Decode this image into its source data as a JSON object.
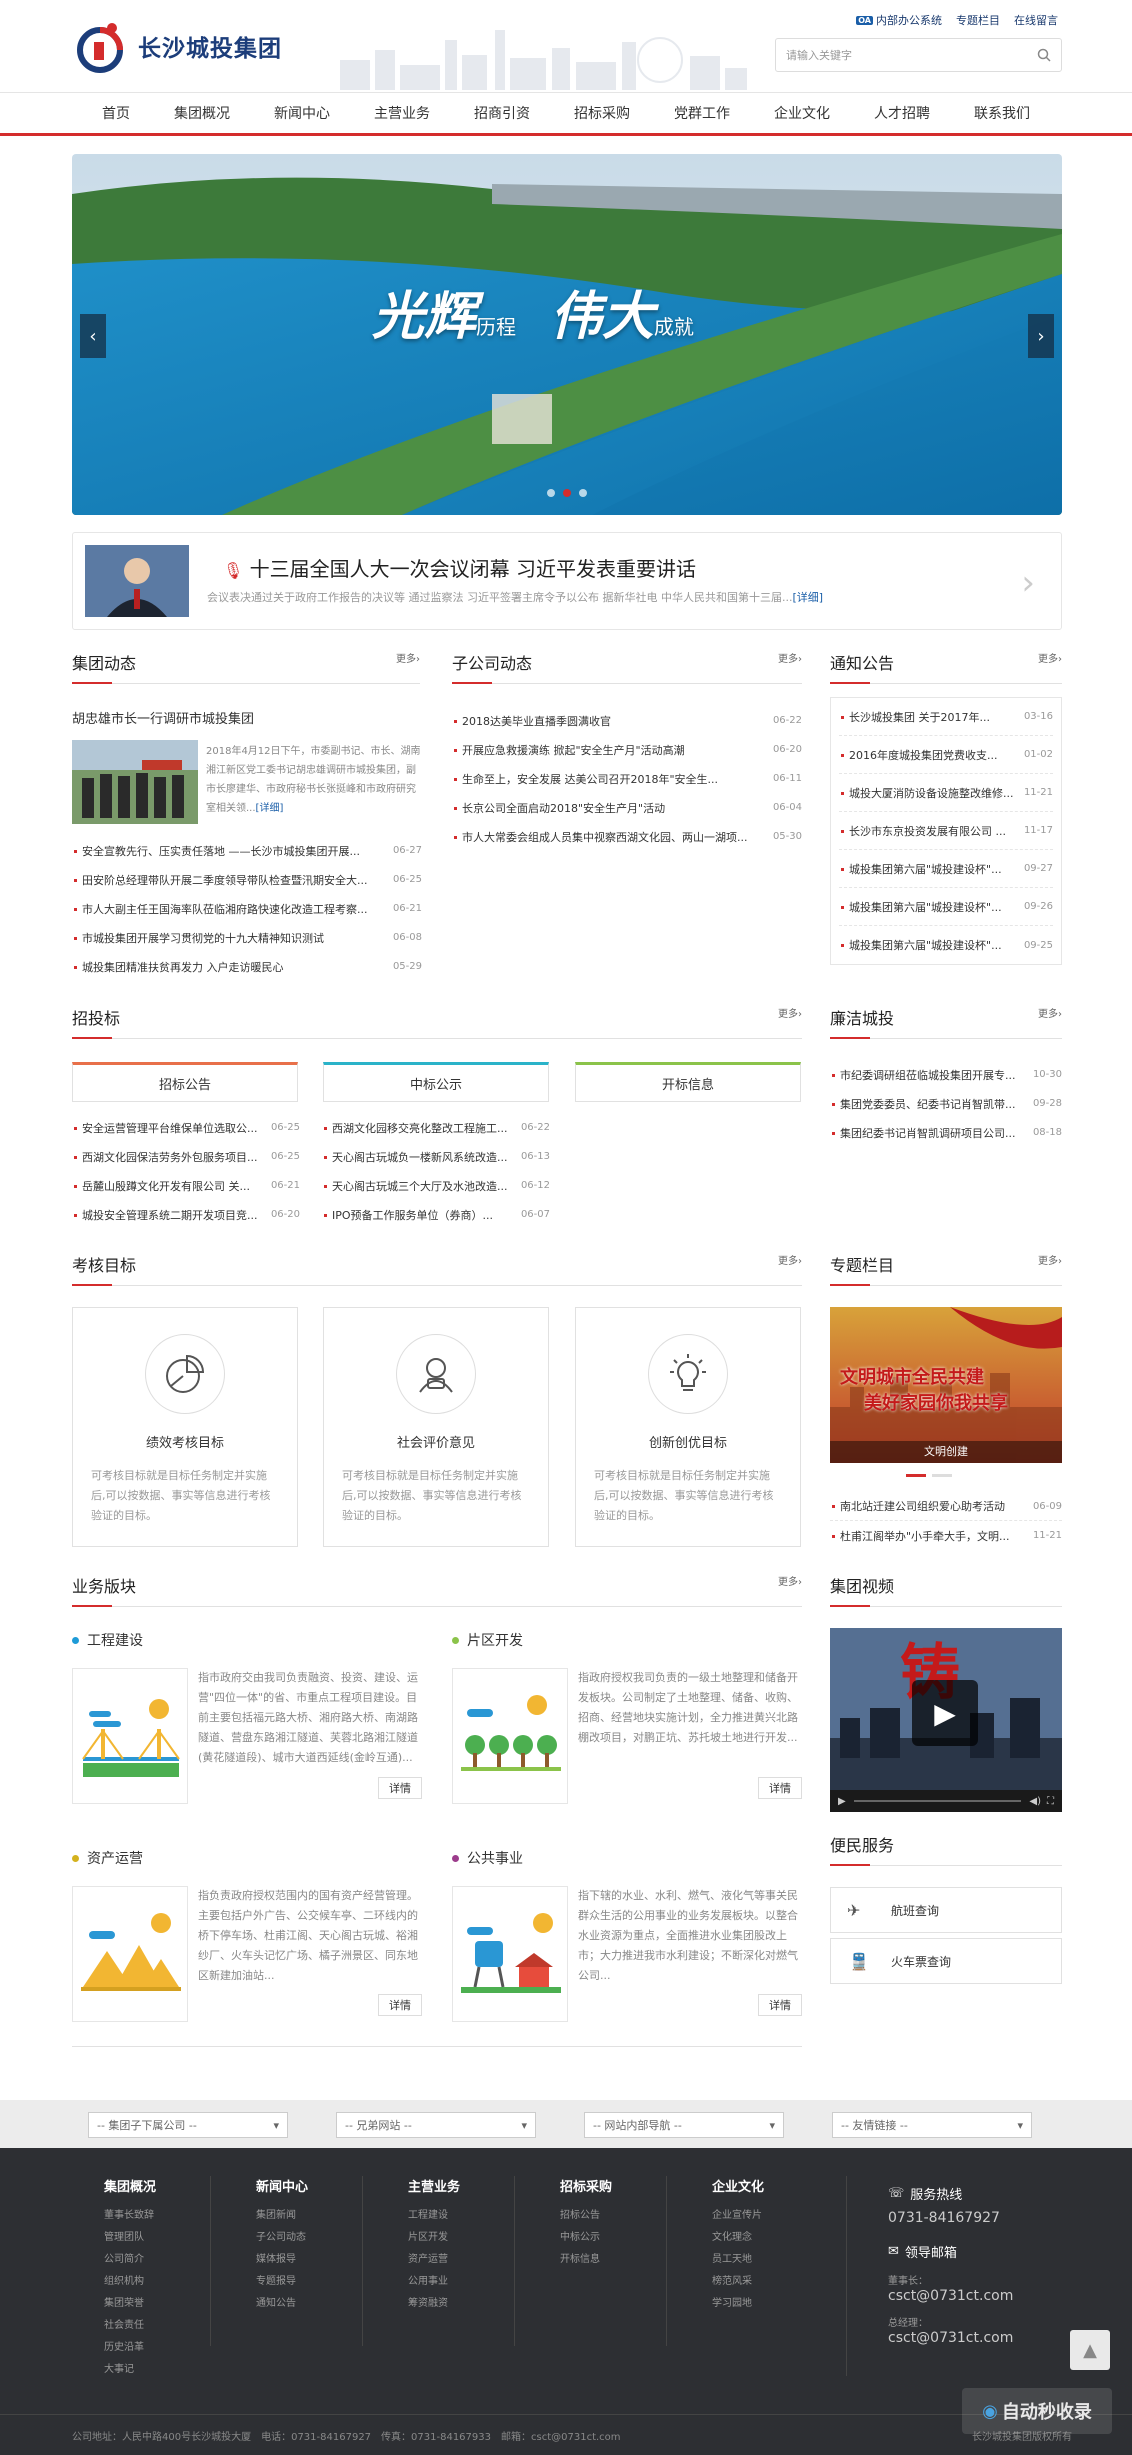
{
  "header": {
    "oa_badge": "OA",
    "top_links": [
      "内部办公系统",
      "专题栏目",
      "在线留言"
    ],
    "logo_text": "长沙城投集团",
    "search_placeholder": "请输入关键字"
  },
  "nav": [
    "首页",
    "集团概况",
    "新闻中心",
    "主营业务",
    "招商引资",
    "招标采购",
    "党群工作",
    "企业文化",
    "人才招聘",
    "联系我们"
  ],
  "banner": {
    "slogan_big_1": "光辉",
    "slogan_small_1": "历程",
    "slogan_big_2": "伟大",
    "slogan_small_2": "成就"
  },
  "headline": {
    "title": "十三届全国人大一次会议闭幕 习近平发表重要讲话",
    "summary": "会议表决通过关于政府工作报告的决议等 通过监察法 习近平签署主席令予以公布 据新华社电 中华人民共和国第十三届...",
    "more": "[详细]"
  },
  "news": {
    "title": "集团动态",
    "more": "更多",
    "feature_title": "胡忠雄市长一行调研市城投集团",
    "feature_text": "2018年4月12日下午，市委副书记、市长、湖南湘江新区党工委书记胡忠雄调研市城投集团，副市长廖建华、市政府秘书长张挺峰和市政府研究室相关领...",
    "feature_more": "[详细]",
    "items": [
      {
        "t": "安全宣教先行、压实责任落地 ——长沙市城投集团开展...",
        "d": "06-27"
      },
      {
        "t": "田安阶总经理带队开展二季度领导带队检查暨汛期安全大...",
        "d": "06-25"
      },
      {
        "t": "市人大副主任王国海率队莅临湘府路快速化改造工程考察...",
        "d": "06-21"
      },
      {
        "t": "市城投集团开展学习贯彻党的十九大精神知识测试",
        "d": "06-08"
      },
      {
        "t": "城投集团精准扶贫再发力 入户走访暖民心",
        "d": "05-29"
      }
    ]
  },
  "sub_news": {
    "title": "子公司动态",
    "more": "更多",
    "items": [
      {
        "t": "2018达美毕业直播季圆满收官",
        "d": "06-22"
      },
      {
        "t": "开展应急救援演练 掀起\"安全生产月\"活动高潮",
        "d": "06-20"
      },
      {
        "t": "生命至上，安全发展 达美公司召开2018年\"安全生...",
        "d": "06-11"
      },
      {
        "t": "长京公司全面启动2018\"安全生产月\"活动",
        "d": "06-04"
      },
      {
        "t": "市人大常委会组成人员集中视察西湖文化园、两山一湖项...",
        "d": "05-30"
      }
    ]
  },
  "notice": {
    "title": "通知公告",
    "more": "更多",
    "items": [
      {
        "t": "长沙城投集团 关于2017年...",
        "d": "03-16"
      },
      {
        "t": "2016年度城投集团党费收支...",
        "d": "01-02"
      },
      {
        "t": "城投大厦消防设备设施整改维修...",
        "d": "11-21"
      },
      {
        "t": "长沙市东京投资发展有限公司 ...",
        "d": "11-17"
      },
      {
        "t": "城投集团第六届\"城投建设杯\"...",
        "d": "09-27"
      },
      {
        "t": "城投集团第六届\"城投建设杯\"...",
        "d": "09-26"
      },
      {
        "t": "城投集团第六届\"城投建设杯\"...",
        "d": "09-25"
      }
    ]
  },
  "bidding": {
    "title": "招投标",
    "more": "更多",
    "tabs": [
      "招标公告",
      "中标公示",
      "开标信息"
    ],
    "col1": [
      {
        "t": "安全运营管理平台维保单位选取公...",
        "d": "06-25"
      },
      {
        "t": "西湖文化园保洁劳务外包服务项目...",
        "d": "06-25"
      },
      {
        "t": "岳麓山殷蹲文化开发有限公司 关...",
        "d": "06-21"
      },
      {
        "t": "城投安全管理系统二期开发项目竞...",
        "d": "06-20"
      }
    ],
    "col2": [
      {
        "t": "西湖文化园移交亮化整改工程施工...",
        "d": "06-22"
      },
      {
        "t": "天心阁古玩城负一楼新风系统改造...",
        "d": "06-13"
      },
      {
        "t": "天心阁古玩城三个大厅及水池改造...",
        "d": "06-12"
      },
      {
        "t": "IPO预备工作服务单位（券商）...",
        "d": "06-07"
      }
    ]
  },
  "integrity": {
    "title": "廉洁城投",
    "more": "更多",
    "items": [
      {
        "t": "市纪委调研组莅临城投集团开展专...",
        "d": "10-30"
      },
      {
        "t": "集团党委委员、纪委书记肖智凯带...",
        "d": "09-28"
      },
      {
        "t": "集团纪委书记肖智凯调研项目公司...",
        "d": "08-18"
      }
    ]
  },
  "goals": {
    "title": "考核目标",
    "more": "更多",
    "cards": [
      {
        "name": "绩效考核目标",
        "desc": "可考核目标就是目标任务制定并实施后,可以按数据、事实等信息进行考核验证的目标。"
      },
      {
        "name": "社会评价意见",
        "desc": "可考核目标就是目标任务制定并实施后,可以按数据、事实等信息进行考核验证的目标。"
      },
      {
        "name": "创新创优目标",
        "desc": "可考核目标就是目标任务制定并实施后,可以按数据、事实等信息进行考核验证的目标。"
      }
    ]
  },
  "special": {
    "title": "专题栏目",
    "more": "更多",
    "banner_line1": "文明城市全民共建",
    "banner_line2": "美好家园你我共享",
    "caption": "文明创建",
    "items": [
      {
        "t": "南北站迁建公司组织爱心助考活动",
        "d": "06-09"
      },
      {
        "t": "杜甫江阁举办\"小手牵大手，文明...",
        "d": "11-21"
      }
    ]
  },
  "business": {
    "title": "业务版块",
    "more": "更多",
    "blocks": [
      {
        "title": "工程建设",
        "color": "#1e9bd7",
        "text": "指市政府交由我司负责融资、投资、建设、运营\"四位一体\"的省、市重点工程项目建设。目前主要包括福元路大桥、湘府路大桥、南湖路隧道、营盘东路湘江隧道、芙蓉北路湘江隧道(黄花隧道段)、城市大道西延线(金岭互通)...",
        "btn": "详情"
      },
      {
        "title": "片区开发",
        "color": "#8bc34a",
        "text": "指政府授权我司负责的一级土地整理和储备开发板块。公司制定了土地整理、储备、收购、招商、经营地块实施计划，全力推进黄兴北路棚改项目，对鹏正坑、苏托坡土地进行开发...",
        "btn": "详情"
      },
      {
        "title": "资产运营",
        "color": "#d4b21e",
        "text": "指负责政府授权范围内的国有资产经营管理。主要包括户外广告、公交候车亭、二环线内的桥下停车场、杜甫江阁、天心阁古玩城、裕湘纱厂、火车头记忆广场、橘子洲景区、同东地区新建加油站...",
        "btn": "详情"
      },
      {
        "title": "公共事业",
        "color": "#9c3c8c",
        "text": "指下辖的水业、水利、燃气、液化气等事关民群众生活的公用事业的业务发展板块。以整合水业资源为重点，全面推进水业集团股改上市；大力推进我市水利建设；不断深化对燃气公司...",
        "btn": "详情"
      }
    ]
  },
  "video": {
    "title": "集团视频",
    "overlay_char": "铸"
  },
  "services": {
    "title": "便民服务",
    "items": [
      "航班查询",
      "火车票查询"
    ]
  },
  "link_bar": [
    "-- 集团子下属公司 --",
    "-- 兄弟网站 --",
    "-- 网站内部导航 --",
    "-- 友情链接 --"
  ],
  "footer": {
    "cols": [
      {
        "h": "集团概况",
        "items": [
          "董事长致辞",
          "管理团队",
          "公司简介",
          "组织机构",
          "集团荣誉",
          "社会责任",
          "历史沿革",
          "大事记"
        ]
      },
      {
        "h": "新闻中心",
        "items": [
          "集团新闻",
          "子公司动态",
          "媒体报导",
          "专题报导",
          "通知公告"
        ]
      },
      {
        "h": "主营业务",
        "items": [
          "工程建设",
          "片区开发",
          "资产运营",
          "公用事业",
          "筹资融资"
        ]
      },
      {
        "h": "招标采购",
        "items": [
          "招标公告",
          "中标公示",
          "开标信息"
        ]
      },
      {
        "h": "企业文化",
        "items": [
          "企业宣传片",
          "文化理念",
          "员工天地",
          "榜范风采",
          "学习园地"
        ]
      }
    ],
    "hotline_label": "服务热线",
    "hotline": "0731-84167927",
    "mailbox_label": "领导邮箱",
    "chairman_label": "董事长：",
    "chairman_email": "csct@0731ct.com",
    "gm_label": "总经理：",
    "gm_email": "csct@0731ct.com",
    "address": "公司地址：人民中路400号长沙城投大厦　电话：0731-84167927　传真：0731-84167933　邮箱：csct@0731ct.com",
    "copyright": "长沙城投集团版权所有",
    "watermark": "自动秒收录"
  }
}
